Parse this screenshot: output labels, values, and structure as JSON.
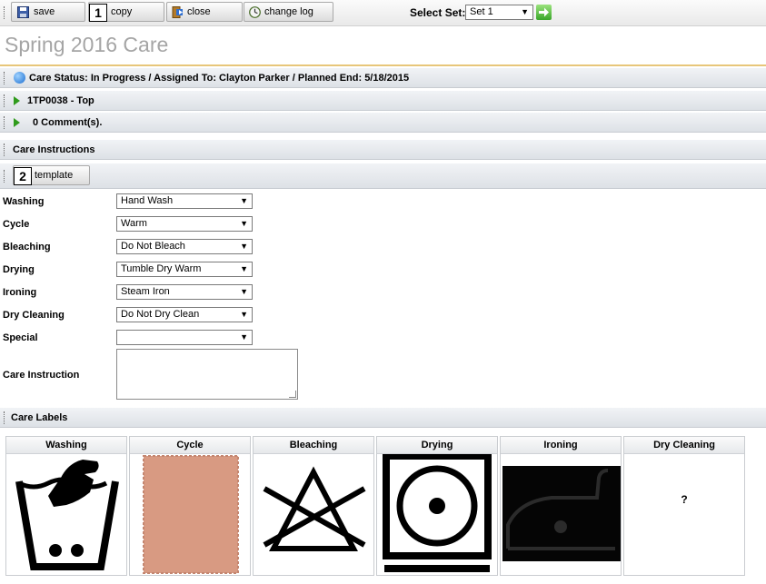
{
  "toolbar": {
    "save_label": "save",
    "copy_number": "1",
    "copy_label": "copy",
    "close_label": "close",
    "change_log_label": "change log",
    "select_set_label": "Select Set:",
    "select_set_value": "Set 1"
  },
  "page": {
    "title": "Spring 2016 Care"
  },
  "sections": {
    "care_status": "Care  Status: In Progress / Assigned To: Clayton Parker / Planned End: 5/18/2015",
    "item": "1TP0038 - Top",
    "comments": "0 Comment(s).",
    "care_instructions": "Care Instructions",
    "template_number": "2",
    "template_label": "template",
    "care_labels": "Care Labels"
  },
  "form": {
    "fields": [
      {
        "label": "Washing",
        "value": "Hand Wash"
      },
      {
        "label": "Cycle",
        "value": "Warm"
      },
      {
        "label": "Bleaching",
        "value": "Do Not Bleach"
      },
      {
        "label": "Drying",
        "value": "Tumble Dry Warm"
      },
      {
        "label": "Ironing",
        "value": "Steam Iron"
      },
      {
        "label": "Dry Cleaning",
        "value": "Do Not Dry Clean"
      },
      {
        "label": "Special",
        "value": ""
      }
    ],
    "care_instruction_label": "Care Instruction",
    "care_instruction_value": ""
  },
  "care_labels": [
    {
      "title": "Washing",
      "icon": "hand-wash-icon"
    },
    {
      "title": "Cycle",
      "icon": "warm-cycle-swatch"
    },
    {
      "title": "Bleaching",
      "icon": "do-not-bleach-icon"
    },
    {
      "title": "Drying",
      "icon": "tumble-dry-icon"
    },
    {
      "title": "Ironing",
      "icon": "steam-iron-icon"
    },
    {
      "title": "Dry Cleaning",
      "icon": "unknown",
      "placeholder": "?"
    }
  ],
  "colors": {
    "title_gray": "#a5a5a5",
    "title_rule": "#e7c67a",
    "expand_green": "#2f9b1c",
    "swatch": "#d89a82"
  }
}
